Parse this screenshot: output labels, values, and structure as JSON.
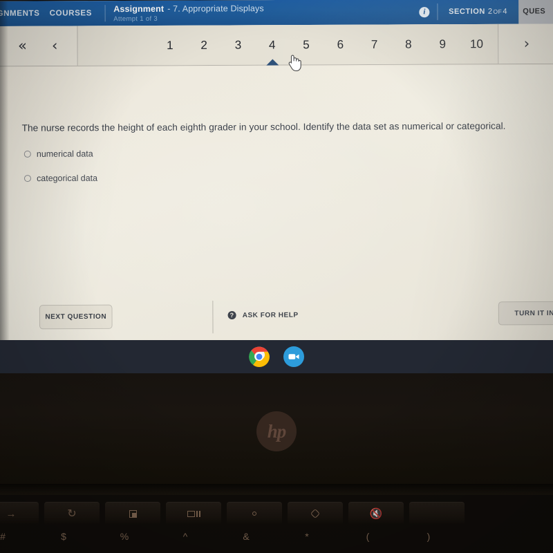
{
  "appbar": {
    "nav_assignments": "IGNMENTS",
    "nav_courses": "COURSES",
    "assignment_word": "Assignment",
    "assignment_title": "- 7. Appropriate Displays",
    "attempt": "Attempt 1 of 3",
    "info_icon": "i",
    "section_label": "SECTION",
    "section_current": "2",
    "section_of": "OF",
    "section_total": "4",
    "question_tab": "QUES",
    "bg_color": "#1e5fa6"
  },
  "pager": {
    "first_chevron": "«",
    "prev_chevron": "‹",
    "next_chevron": "›",
    "pages": [
      "1",
      "2",
      "3",
      "4",
      "5",
      "6",
      "7",
      "8",
      "9",
      "10"
    ],
    "active_page": "4",
    "marker_color": "#2c4f78"
  },
  "question": {
    "text": "The nurse records the height of each eighth grader in your school. Identify the data set as numerical or categorical.",
    "choices": [
      {
        "label": "numerical data",
        "selected": false
      },
      {
        "label": "categorical data",
        "selected": false
      }
    ]
  },
  "footer": {
    "next_question": "NEXT QUESTION",
    "ask_for_help": "ASK FOR HELP",
    "help_icon": "?",
    "turn_it_in": "TURN IT IN"
  },
  "shelf": {
    "chrome_icon": "chrome-icon",
    "zoom_icon": "video-camera-icon",
    "bg_color": "#232833"
  },
  "laptop": {
    "brand": "hp",
    "function_keys": [
      "forward-arrow-icon",
      "refresh-icon",
      "fullscreen-icon",
      "window-overview-icon",
      "brightness-down-icon",
      "brightness-up-icon",
      "mute-icon"
    ],
    "number_row_symbols": [
      "#",
      "$",
      "%",
      "^",
      "&",
      "*",
      "(",
      ")"
    ]
  }
}
